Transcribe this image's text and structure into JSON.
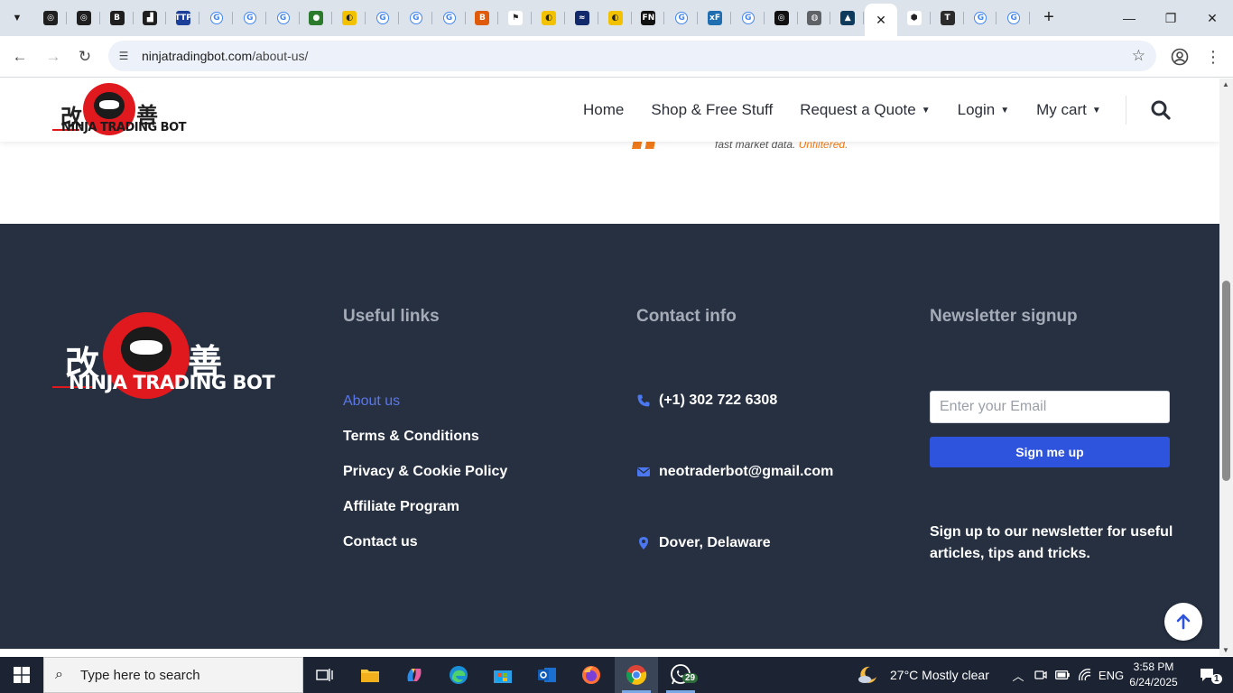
{
  "browser": {
    "tabs": [
      {
        "icon": "openai-icon",
        "glyph": "◎",
        "bg": "#1f1f1f"
      },
      {
        "icon": "openai-icon",
        "glyph": "◎",
        "bg": "#1f1f1f"
      },
      {
        "icon": "b-logo-icon",
        "glyph": "B",
        "bg": "#1f1f1f"
      },
      {
        "icon": "chart-logo-icon",
        "glyph": "▟",
        "bg": "#1f1f1f"
      },
      {
        "icon": "ttp-icon",
        "glyph": "TTP",
        "bg": "#1c3f9a"
      },
      {
        "icon": "google-icon",
        "glyph": "G",
        "bg": "#ffffff"
      },
      {
        "icon": "google-icon",
        "glyph": "G",
        "bg": "#ffffff"
      },
      {
        "icon": "google-icon",
        "glyph": "G",
        "bg": "#ffffff"
      },
      {
        "icon": "green-globe-icon",
        "glyph": "●",
        "bg": "#2c7a2c"
      },
      {
        "icon": "yellow-logo-icon",
        "glyph": "◐",
        "bg": "#f2c200"
      },
      {
        "icon": "google-icon",
        "glyph": "G",
        "bg": "#ffffff"
      },
      {
        "icon": "google-icon",
        "glyph": "G",
        "bg": "#ffffff"
      },
      {
        "icon": "google-icon",
        "glyph": "G",
        "bg": "#ffffff"
      },
      {
        "icon": "orange-b-icon",
        "glyph": "B",
        "bg": "#e05a0c"
      },
      {
        "icon": "trading-icon",
        "glyph": "⚑",
        "bg": "#ffffff"
      },
      {
        "icon": "yellow-logo-icon",
        "glyph": "◐",
        "bg": "#f2c200"
      },
      {
        "icon": "chart-dark-icon",
        "glyph": "≈",
        "bg": "#122a6b"
      },
      {
        "icon": "yellow-logo-icon",
        "glyph": "◐",
        "bg": "#f2c200"
      },
      {
        "icon": "fn-icon",
        "glyph": "FN",
        "bg": "#111111"
      },
      {
        "icon": "google-icon",
        "glyph": "G",
        "bg": "#ffffff"
      },
      {
        "icon": "xf-icon",
        "glyph": "xF",
        "bg": "#1f6fb0"
      },
      {
        "icon": "google-icon",
        "glyph": "G",
        "bg": "#ffffff"
      },
      {
        "icon": "openai-square-icon",
        "glyph": "◎",
        "bg": "#111111"
      },
      {
        "icon": "globe-icon",
        "glyph": "◍",
        "bg": "#5f6368"
      },
      {
        "icon": "blue-arrow-icon",
        "glyph": "▲",
        "bg": "#0f3a5c"
      },
      {
        "icon": "active-tab",
        "glyph": "✕",
        "bg": "#ffffff"
      },
      {
        "icon": "blue-hex-icon",
        "glyph": "⬢",
        "bg": "#ffffff"
      },
      {
        "icon": "t-logo-icon",
        "glyph": "T",
        "bg": "#2b2b2b"
      },
      {
        "icon": "google-icon",
        "glyph": "G",
        "bg": "#ffffff"
      },
      {
        "icon": "google-icon",
        "glyph": "G",
        "bg": "#ffffff"
      }
    ],
    "url_host": "ninjatradingbot.com",
    "url_path": "/about-us/"
  },
  "site": {
    "logo_kanji_left": "改",
    "logo_kanji_right": "善",
    "logo_wordmark": "NINJA TRADING BOT",
    "nav": [
      {
        "label": "Home",
        "has_caret": false
      },
      {
        "label": "Shop & Free Stuff",
        "has_caret": false
      },
      {
        "label": "Request a Quote",
        "has_caret": true
      },
      {
        "label": "Login",
        "has_caret": true
      },
      {
        "label": "My cart",
        "has_caret": true
      }
    ],
    "banner_text": "fast market data.",
    "banner_accent": "Unfiltered."
  },
  "footer": {
    "useful_links_title": "Useful links",
    "links": [
      "About us",
      "Terms & Conditions",
      "Privacy & Cookie Policy",
      "Affiliate Program",
      "Contact us"
    ],
    "contact_title": "Contact info",
    "phone": "(+1) 302 722 6308",
    "email": "neotraderbot@gmail.com",
    "location": "Dover, Delaware",
    "newsletter_title": "Newsletter signup",
    "email_placeholder": "Enter your Email",
    "signup_label": "Sign me up",
    "newsletter_text": "Sign up to our newsletter for useful articles, tips and tricks."
  },
  "taskbar": {
    "search_placeholder": "Type here to search",
    "whatsapp_badge": "29",
    "weather": "27°C  Mostly clear",
    "language": "ENG",
    "time": "3:58 PM",
    "date": "6/24/2025",
    "notification_count": "1"
  },
  "colors": {
    "footer_bg": "#263041",
    "accent_blue": "#2e53dc",
    "link_blue": "#5b77e8",
    "logo_red": "#e0191f"
  }
}
